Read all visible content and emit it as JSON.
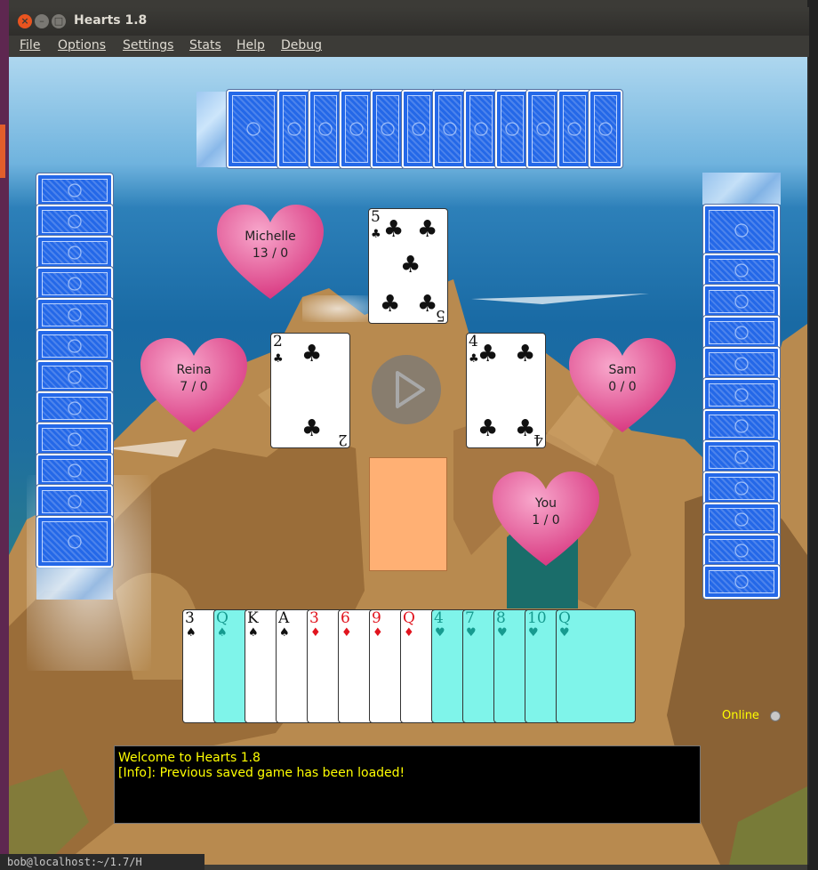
{
  "window": {
    "title": "Hearts 1.8"
  },
  "window_controls": {
    "close": "×",
    "minimize": "–",
    "maximize": "□"
  },
  "menu": {
    "items": [
      "File",
      "Options",
      "Settings",
      "Stats",
      "Help",
      "Debug"
    ]
  },
  "players": {
    "michelle": {
      "name": "Michelle",
      "score": "13 / 0"
    },
    "reina": {
      "name": "Reina",
      "score": "7 / 0"
    },
    "sam": {
      "name": "Sam",
      "score": "0 / 0"
    },
    "you": {
      "name": "You",
      "score": "1 / 0"
    }
  },
  "trick": {
    "top": {
      "rank": "5",
      "suit": "♣"
    },
    "left": {
      "rank": "2",
      "suit": "♣"
    },
    "right": {
      "rank": "4",
      "suit": "♣"
    }
  },
  "hand": [
    {
      "rank": "3",
      "suit": "♠",
      "color": "black",
      "playable": false
    },
    {
      "rank": "Q",
      "suit": "♠",
      "color": "black",
      "playable": true
    },
    {
      "rank": "K",
      "suit": "♠",
      "color": "black",
      "playable": false
    },
    {
      "rank": "A",
      "suit": "♠",
      "color": "black",
      "playable": false
    },
    {
      "rank": "3",
      "suit": "♦",
      "color": "red",
      "playable": false
    },
    {
      "rank": "6",
      "suit": "♦",
      "color": "red",
      "playable": false
    },
    {
      "rank": "9",
      "suit": "♦",
      "color": "red",
      "playable": false
    },
    {
      "rank": "Q",
      "suit": "♦",
      "color": "red",
      "playable": false
    },
    {
      "rank": "4",
      "suit": "♥",
      "color": "red",
      "playable": true
    },
    {
      "rank": "7",
      "suit": "♥",
      "color": "red",
      "playable": true
    },
    {
      "rank": "8",
      "suit": "♥",
      "color": "red",
      "playable": true
    },
    {
      "rank": "10",
      "suit": "♥",
      "color": "red",
      "playable": true
    },
    {
      "rank": "Q",
      "suit": "♥",
      "color": "red",
      "playable": true
    }
  ],
  "status": {
    "online_label": "Online"
  },
  "log": {
    "lines": [
      "Welcome to Hearts 1.8",
      "[Info]: Previous saved game has been loaded!"
    ]
  },
  "terminal": {
    "text": "bob@localhost:~/1.7/H"
  },
  "colors": {
    "card_back": "#2468e8",
    "heart_pink": "#e8559a",
    "highlight": "#7ff4ea",
    "placeholder": "#ffb074",
    "log_text": "#ffff00"
  }
}
